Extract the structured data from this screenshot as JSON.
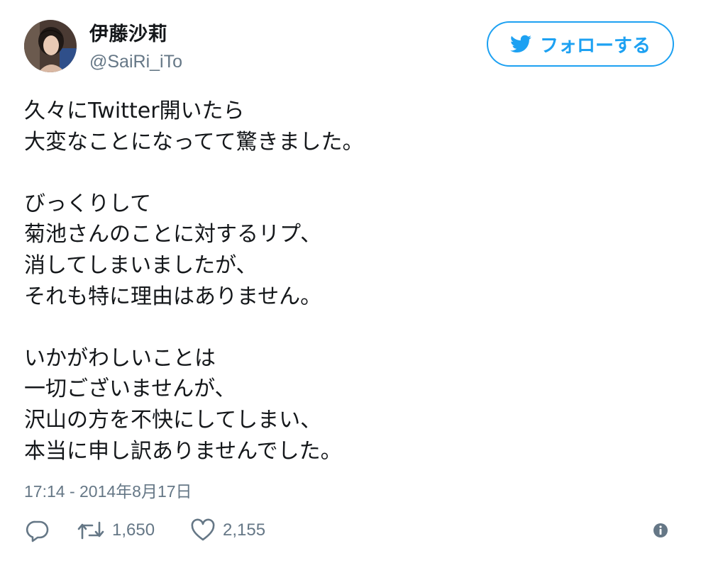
{
  "user": {
    "display_name": "伊藤沙莉",
    "screen_name": "@SaiRi_iTo"
  },
  "follow_button": {
    "label": "フォローする",
    "icon": "twitter-bird-icon"
  },
  "tweet": {
    "lines": [
      "久々にTwitter開いたら",
      "大変なことになってて驚きました。",
      "",
      "びっくりして",
      "菊池さんのことに対するリプ、",
      "消してしまいましたが、",
      "それも特に理由はありません。",
      "",
      "いかがわしいことは",
      "一切ございませんが、",
      "沢山の方を不快にしてしまい、",
      "本当に申し訳ありませんでした。"
    ],
    "timestamp": "17:14 - 2014年8月17日"
  },
  "actions": {
    "reply": {
      "icon": "reply-icon"
    },
    "retweet": {
      "icon": "retweet-icon",
      "count": "1,650"
    },
    "like": {
      "icon": "heart-icon",
      "count": "2,155"
    },
    "info": {
      "icon": "info-icon"
    }
  },
  "colors": {
    "accent": "#1da1f2",
    "text": "#14171a",
    "secondary": "#657786"
  }
}
